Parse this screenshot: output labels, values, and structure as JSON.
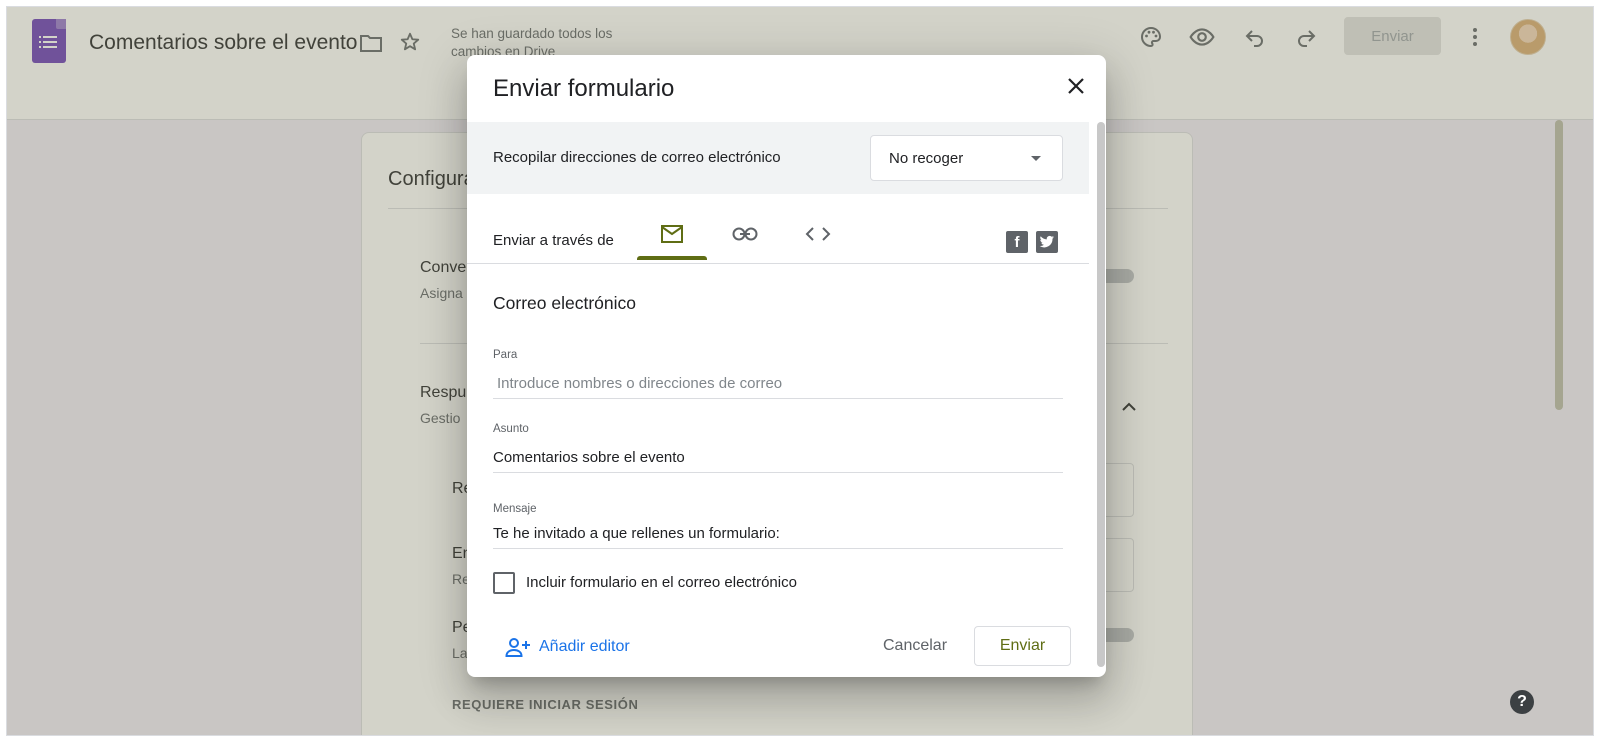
{
  "header": {
    "doc_title": "Comentarios sobre el evento",
    "save_status": "Se han guardado todos los cambios en Drive",
    "send_button": "Enviar",
    "icons": [
      "forms-app-icon",
      "folder-icon",
      "star-icon",
      "palette-icon",
      "preview-eye-icon",
      "undo-icon",
      "redo-icon",
      "more-vert-icon",
      "avatar"
    ]
  },
  "background": {
    "section_title": "Configura",
    "rows": [
      {
        "title": "Conve",
        "subtitle": "Asigna"
      },
      {
        "title": "Respu",
        "subtitle": "Gestio"
      },
      {
        "title": "Re",
        "subtitle": ""
      },
      {
        "title": "En",
        "subtitle": "Re"
      },
      {
        "title": "Pe",
        "subtitle": "La"
      }
    ],
    "requires_login": "REQUIERE INICIAR SESIÓN"
  },
  "dialog": {
    "title": "Enviar formulario",
    "collect_label": "Recopilar direcciones de correo electrónico",
    "collect_value": "No recoger",
    "send_via_label": "Enviar a través de",
    "tabs": [
      {
        "name": "email-tab",
        "icon": "mail-icon",
        "active": true
      },
      {
        "name": "link-tab",
        "icon": "link-icon",
        "active": false
      },
      {
        "name": "embed-tab",
        "icon": "code-icon",
        "active": false
      }
    ],
    "social": [
      "facebook-icon",
      "twitter-icon"
    ],
    "section_title": "Correo electrónico",
    "to_label": "Para",
    "to_placeholder": "Introduce nombres o direcciones de correo",
    "subject_label": "Asunto",
    "subject_value": "Comentarios sobre el evento",
    "message_label": "Mensaje",
    "message_value": "Te he invitado a que rellenes un formulario:",
    "include_form_label": "Incluir formulario en el correo electrónico",
    "include_form_checked": false,
    "add_editor": "Añadir editor",
    "cancel": "Cancelar",
    "send": "Enviar"
  },
  "colors": {
    "accent": "#5f6d14",
    "link_blue": "#1a73e8",
    "forms_purple": "#673ab7"
  }
}
